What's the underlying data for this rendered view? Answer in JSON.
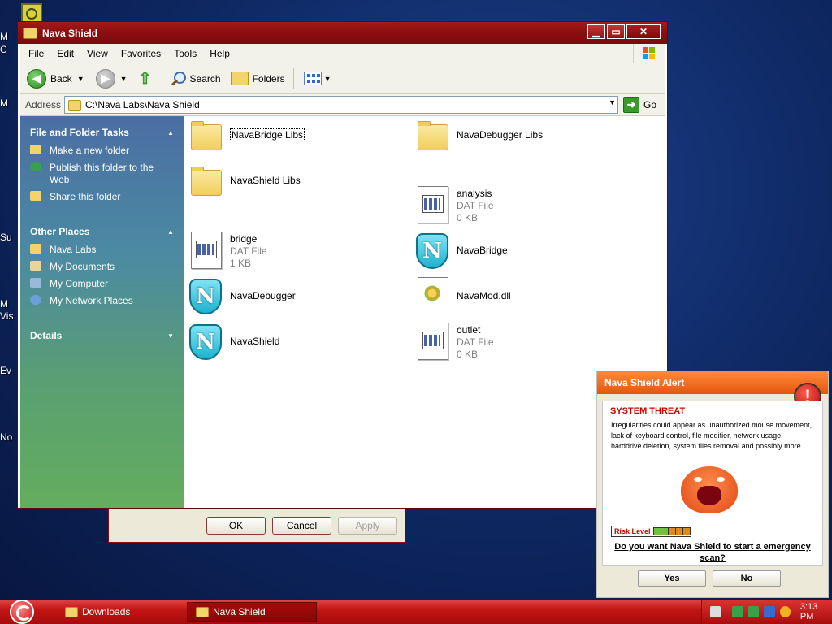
{
  "desktop": {
    "labels": [
      "M",
      "C",
      "M",
      "Su",
      "M",
      "Vis",
      "Ev",
      "No"
    ]
  },
  "window": {
    "title": "Nava Shield",
    "buttons": {
      "minimize": "▁",
      "maximize": "▭",
      "close": "✕"
    }
  },
  "menu": [
    "File",
    "Edit",
    "View",
    "Favorites",
    "Tools",
    "Help"
  ],
  "toolbar": {
    "back": "Back",
    "search": "Search",
    "folders": "Folders"
  },
  "address": {
    "label": "Address",
    "path": "C:\\Nava Labs\\Nava Shield",
    "go": "Go"
  },
  "taskpane": {
    "sections": [
      {
        "title": "File and Folder Tasks",
        "items": [
          "Make a new folder",
          "Publish this folder to the Web",
          "Share this folder"
        ]
      },
      {
        "title": "Other Places",
        "items": [
          "Nava Labs",
          "My Documents",
          "My Computer",
          "My Network Places"
        ]
      },
      {
        "title": "Details",
        "items": []
      }
    ]
  },
  "files": [
    {
      "name": "NavaBridge Libs",
      "type": "",
      "size": "",
      "icon": "folder-icon"
    },
    {
      "name": "NavaDebugger Libs",
      "type": "",
      "size": "",
      "icon": "folder-icon"
    },
    {
      "name": "NavaShield Libs",
      "type": "",
      "size": "",
      "icon": "folder-icon"
    },
    {
      "name": "analysis",
      "type": "DAT File",
      "size": "0 KB",
      "icon": "dat-file-icon"
    },
    {
      "name": "bridge",
      "type": "DAT File",
      "size": "1 KB",
      "icon": "dat-file-icon"
    },
    {
      "name": "NavaBridge",
      "type": "",
      "size": "",
      "icon": "nava-shield-app-icon"
    },
    {
      "name": "NavaDebugger",
      "type": "",
      "size": "",
      "icon": "nava-shield-app-icon"
    },
    {
      "name": "NavaMod.dll",
      "type": "",
      "size": "",
      "icon": "dll-file-icon"
    },
    {
      "name": "NavaShield",
      "type": "",
      "size": "",
      "icon": "nava-shield-app-icon"
    },
    {
      "name": "outlet",
      "type": "DAT File",
      "size": "0 KB",
      "icon": "dat-file-icon"
    }
  ],
  "dialog": {
    "ok": "OK",
    "cancel": "Cancel",
    "apply": "Apply"
  },
  "alert": {
    "title": "Nava Shield Alert",
    "threat": "SYSTEM THREAT",
    "description": "Irregularities could appear as unauthorized mouse movement, lack of keyboard control, file modifier, network usage, harddrive deletion, system files removal and possibly more.",
    "risk_label": "Risk Level",
    "risk_level_filled": 2,
    "risk_level_total": 5,
    "question": "Do you want Nava Shield to start a emergency scan?",
    "yes": "Yes",
    "no": "No"
  },
  "taskbar": {
    "tasks": [
      "Downloads",
      "Nava Shield"
    ],
    "clock": "3:13 PM"
  },
  "colors": {
    "title_bar": "#8b0f10",
    "taskbar": "#c21616",
    "alert_header": "#e5560d",
    "threat_text": "#cc0000"
  }
}
